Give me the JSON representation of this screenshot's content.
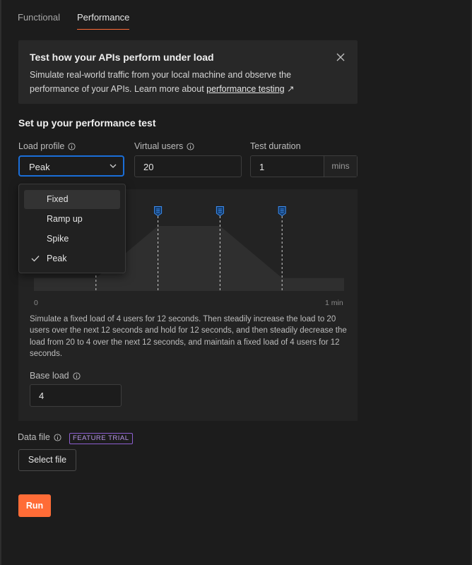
{
  "tabs": [
    {
      "label": "Functional",
      "active": false
    },
    {
      "label": "Performance",
      "active": true
    }
  ],
  "banner": {
    "title": "Test how your APIs perform under load",
    "text_before_link": "Simulate real-world traffic from your local machine and observe the performance of your APIs. Learn more about ",
    "link_text": "performance testing",
    "link_arrow": "↗"
  },
  "setup": {
    "title": "Set up your performance test",
    "load_profile_label": "Load profile",
    "load_profile_value": "Peak",
    "virtual_users_label": "Virtual users",
    "virtual_users_value": "20",
    "test_duration_label": "Test duration",
    "test_duration_value": "1",
    "test_duration_unit": "mins"
  },
  "load_profile_options": [
    {
      "label": "Fixed",
      "highlighted": true,
      "selected": false
    },
    {
      "label": "Ramp up",
      "highlighted": false,
      "selected": false
    },
    {
      "label": "Spike",
      "highlighted": false,
      "selected": false
    },
    {
      "label": "Peak",
      "highlighted": false,
      "selected": true
    }
  ],
  "chart": {
    "x_start_label": "0",
    "x_end_label": "1 min",
    "description": "Simulate a fixed load of 4 users for 12 seconds. Then steadily increase the load to 20 users over the next 12 seconds and hold for 12 seconds, and then steadily decrease the load from 20 to 4 over the next 12 seconds, and maintain a fixed load of 4 users for 12 seconds.",
    "base_load_label": "Base load",
    "base_load_value": "4"
  },
  "chart_data": {
    "type": "area",
    "x_unit": "seconds",
    "x": [
      0,
      12,
      24,
      36,
      48,
      60
    ],
    "y": [
      4,
      4,
      20,
      20,
      4,
      4
    ],
    "xlim": [
      0,
      60
    ],
    "ylim": [
      0,
      20
    ],
    "phase_markers": [
      12,
      24,
      36,
      48
    ]
  },
  "data_file": {
    "label": "Data file",
    "badge": "FEATURE TRIAL",
    "button_label": "Select file"
  },
  "run": {
    "label": "Run"
  },
  "colors": {
    "accent": "#ff6c37",
    "focus_blue": "#1a6ed8",
    "badge_purple": "#8e5fd1"
  }
}
